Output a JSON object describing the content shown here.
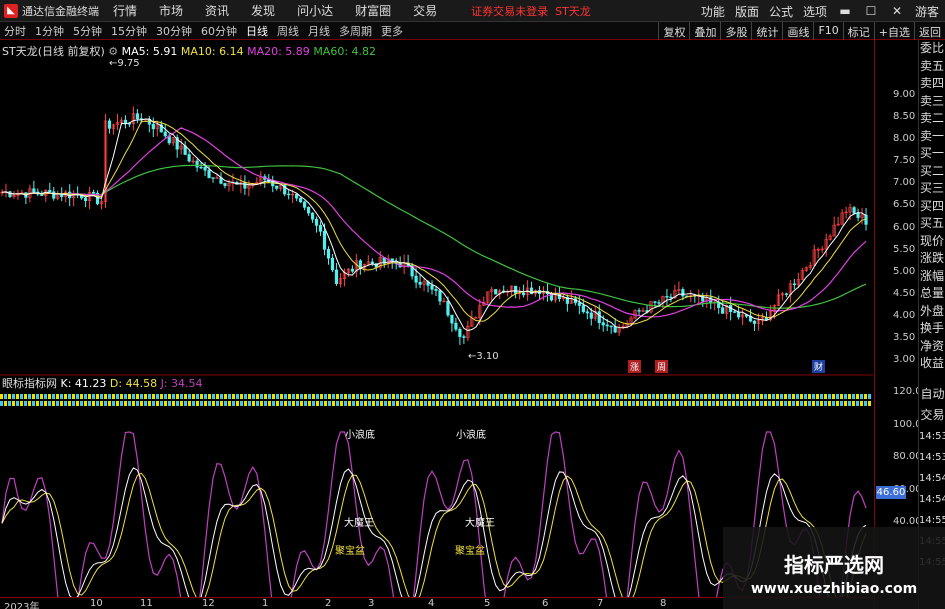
{
  "app": {
    "title": "通达信金融终端",
    "warning": "证券交易未登录",
    "stock_name": "ST天龙"
  },
  "menu": [
    "行情",
    "市场",
    "资讯",
    "发现",
    "问小达",
    "财富圈",
    "交易"
  ],
  "right_menu": [
    "功能",
    "版面",
    "公式",
    "选项",
    "游客"
  ],
  "timeframes": [
    "分时",
    "1分钟",
    "5分钟",
    "15分钟",
    "30分钟",
    "60分钟",
    "日线",
    "周线",
    "月线",
    "多周期",
    "更多"
  ],
  "right_tools": [
    "复权",
    "叠加",
    "多股",
    "统计",
    "画线",
    "F10",
    "标记",
    "+自选",
    "返回"
  ],
  "legend": {
    "stock": "ST天龙(日线 前复权)",
    "ma5": "MA5: 5.91",
    "ma10": "MA10: 6.14",
    "ma20": "MA20: 5.89",
    "ma60": "MA60: 4.82",
    "high_label": "9.75",
    "low_label": "3.10"
  },
  "indicator_legend": {
    "name": "眼标指标网",
    "k": "K: 41.23",
    "d": "D: 44.58",
    "j": "J: 34.54"
  },
  "side_panel": [
    "委比",
    "卖五",
    "卖四",
    "卖三",
    "卖二",
    "卖一",
    "买一",
    "买二",
    "买三",
    "买四",
    "买五",
    "现价",
    "涨跌",
    "涨幅",
    "总量",
    "外盘",
    "换手",
    "净资",
    "收益"
  ],
  "side_panel_bottom": [
    "自动",
    "交易",
    "14:53",
    "14:53",
    "14:54",
    "14:54",
    "14:55",
    "14:55",
    "14:55"
  ],
  "price_ticks": [
    "9.00",
    "8.50",
    "8.00",
    "7.50",
    "7.00",
    "6.50",
    "6.00",
    "5.50",
    "5.00",
    "4.50",
    "4.00",
    "3.50",
    "3.00"
  ],
  "ind_ticks": [
    "120.0",
    "100.0",
    "80.00",
    "60.00",
    "40.00"
  ],
  "current_value": "46.60",
  "x_ticks": [
    "2023年",
    "10",
    "11",
    "12",
    "1",
    "2",
    "3",
    "4",
    "5",
    "6",
    "7",
    "8"
  ],
  "annotations": {
    "xiaolingdi": "小浪底",
    "damowang": "大魔王",
    "jubaopen": "聚宝盆",
    "badge_zhang": "涨",
    "badge_zhou": "周",
    "badge_cai": "财"
  },
  "watermark": {
    "line1": "指标严选网",
    "line2": "www.xuezhibiao.com"
  },
  "colors": {
    "up": "#ff4444",
    "down": "#54f0f0",
    "ma5": "#ffffff",
    "ma10": "#f0e040",
    "ma20": "#e040e0",
    "ma60": "#40c040",
    "k": "#ffffff",
    "d": "#f0e040",
    "j": "#c040c0",
    "band_yellow": "#f0e000",
    "band_cyan": "#40c8f0"
  }
}
